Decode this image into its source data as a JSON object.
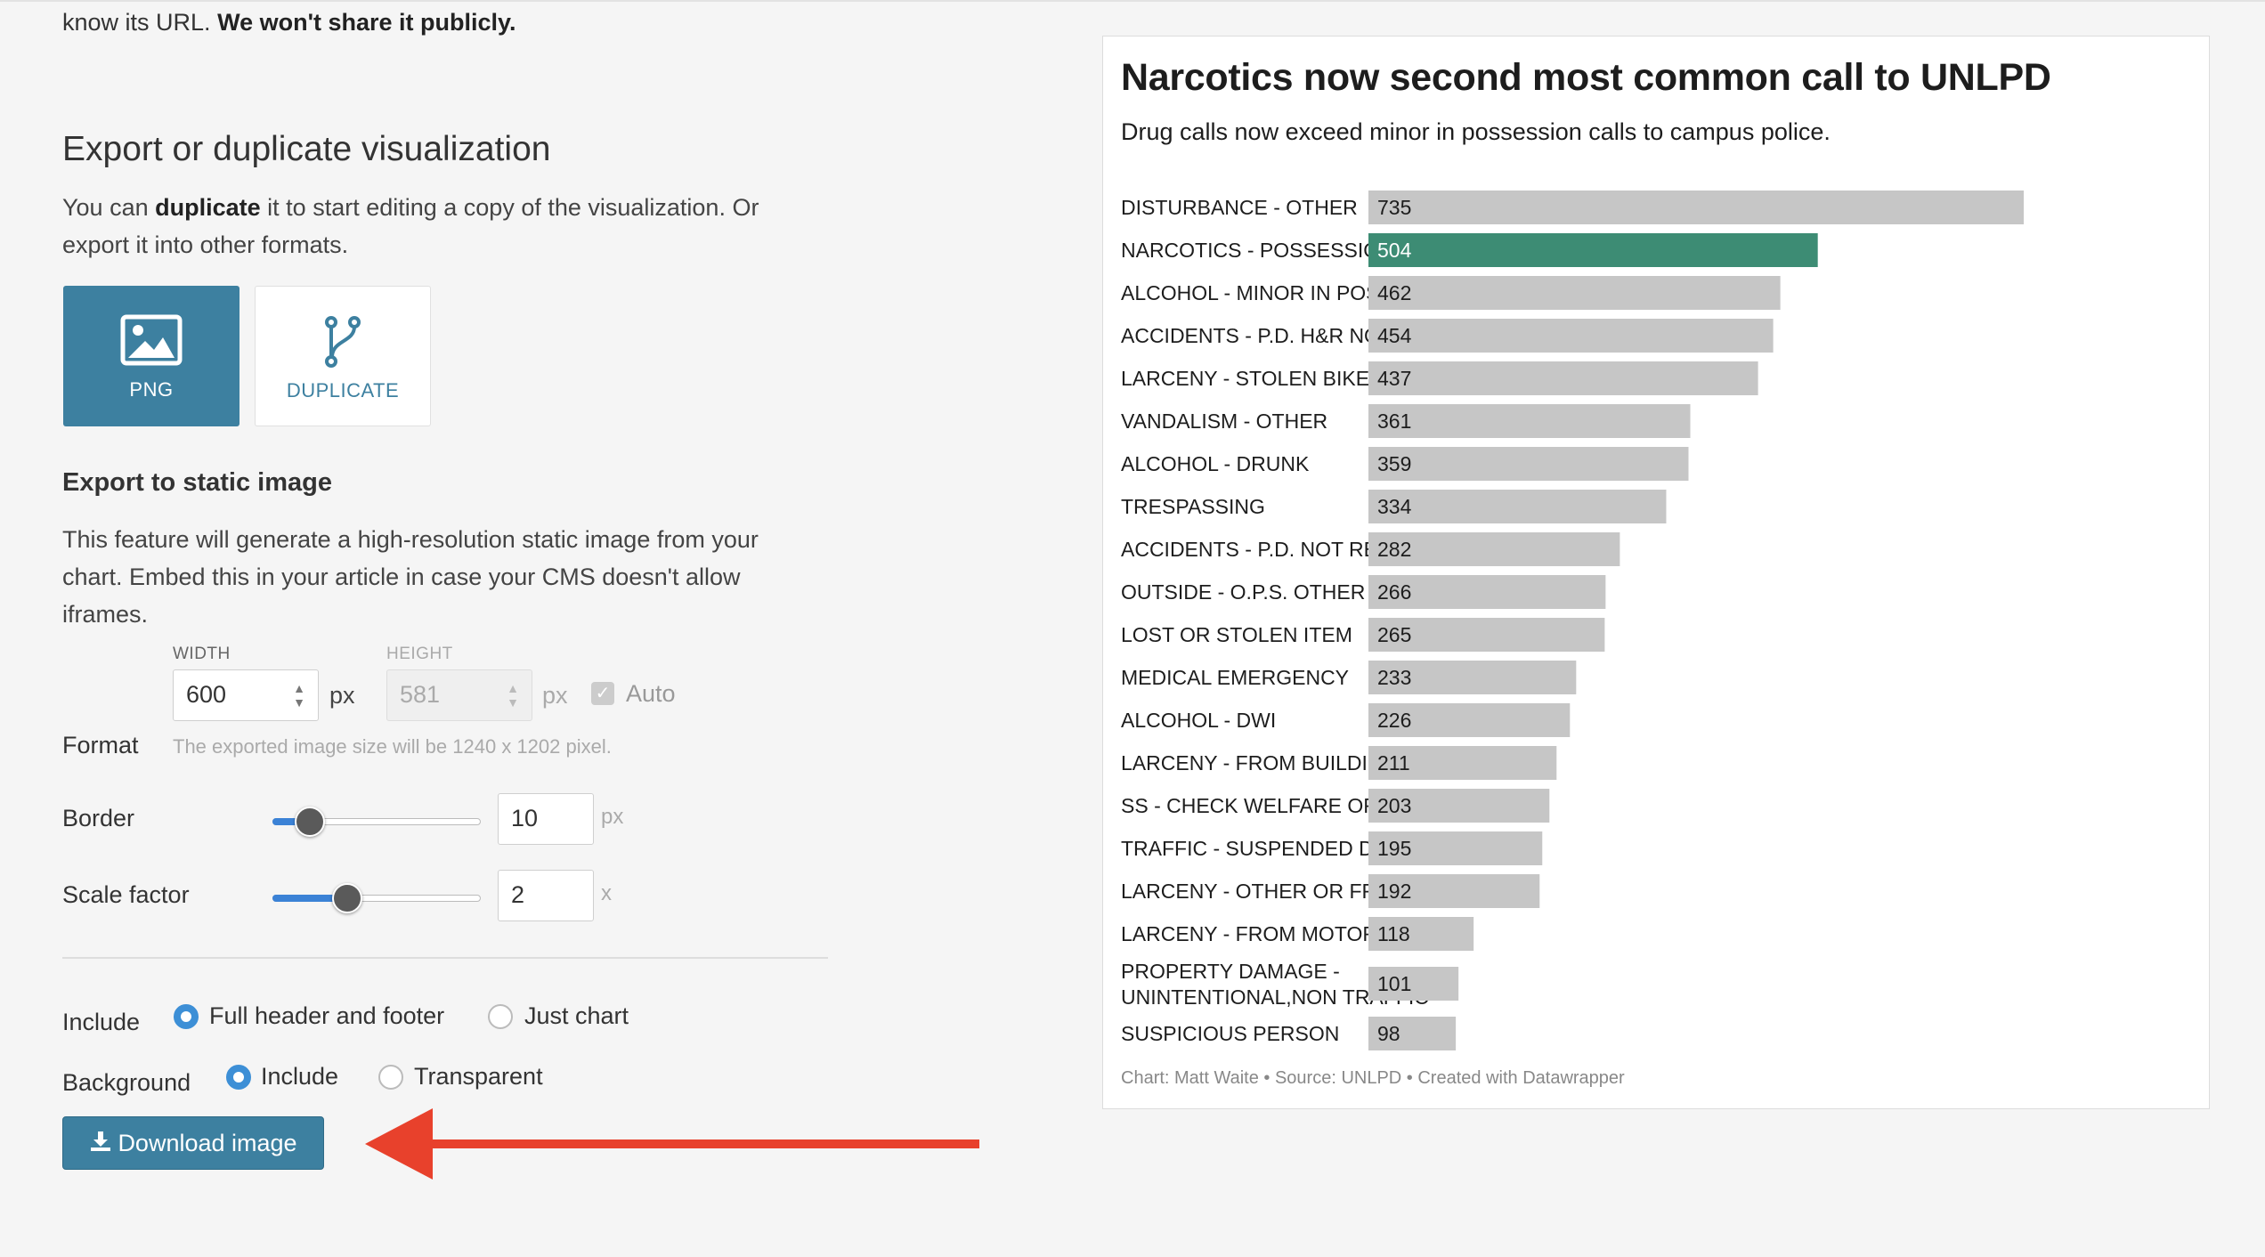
{
  "intro": {
    "text": "know its URL.",
    "bold": "We won't share it publicly."
  },
  "export": {
    "heading": "Export or duplicate visualization",
    "desc_pre": "You can",
    "desc_bold": "duplicate",
    "desc_post": "it to start editing a copy of the visualization. Or export it into other formats.",
    "png_label": "PNG",
    "duplicate_label": "DUPLICATE",
    "png_icon": "image-icon",
    "duplicate_icon": "fork-icon"
  },
  "static": {
    "heading": "Export to static image",
    "desc": "This feature will generate a high-resolution static image from your chart. Embed this in your article in case your CMS doesn't allow iframes.",
    "width_label": "WIDTH",
    "width_value": "600",
    "height_label": "HEIGHT",
    "height_value": "581",
    "unit_px": "px",
    "auto_label": "Auto",
    "auto_checked": true,
    "format_label": "Format",
    "format_hint": "The exported image size will be 1240 x 1202 pixel.",
    "border_label": "Border",
    "border_value": "10",
    "border_unit": "px",
    "border_level": 0.18,
    "scale_label": "Scale factor",
    "scale_value": "2",
    "scale_unit": "x",
    "scale_level": 0.36,
    "include_label": "Include",
    "include_options": [
      "Full header and footer",
      "Just chart"
    ],
    "include_selected": "Full header and footer",
    "background_label": "Background",
    "background_options": [
      "Include",
      "Transparent"
    ],
    "background_selected": "Include",
    "download_label": "Download image",
    "download_icon": "download-icon"
  },
  "annotation": {
    "arrow_color": "#e8412c"
  },
  "colors": {
    "accent": "#3d80a0",
    "bar_default": "#c6c6c6",
    "bar_highlight": "#3d8c74"
  },
  "chart": {
    "title": "Narcotics now second most common call to UNLPD",
    "subtitle": "Drug calls now exceed minor in possession calls to campus police.",
    "footer": "Chart: Matt Waite • Source: UNLPD • Created with Datawrapper"
  },
  "chart_data": {
    "type": "bar",
    "orientation": "horizontal",
    "categories": [
      "DISTURBANCE - OTHER",
      "NARCOTICS - POSSESSION",
      "ALCOHOL - MINOR IN POSSESSION",
      "ACCIDENTS - P.D. H&R NOT REPORTABLE",
      "LARCENY - STOLEN BIKE",
      "VANDALISM - OTHER",
      "ALCOHOL - DRUNK",
      "TRESPASSING",
      "ACCIDENTS - P.D. NOT REPORTABLE",
      "OUTSIDE - O.P.S. OTHER",
      "LOST OR STOLEN ITEM",
      "MEDICAL EMERGENCY",
      "ALCOHOL - DWI",
      "LARCENY - FROM BUILDING",
      "SS - CHECK WELFARE OF PERSON",
      "TRAFFIC - SUSPENDED DRIVER",
      "LARCENY - OTHER OR FROM OPEN AREA",
      "LARCENY - FROM MOTOR VEHICLE",
      "PROPERTY DAMAGE - UNINTENTIONAL,NON TRAFFIC",
      "SUSPICIOUS PERSON"
    ],
    "label_lines": [
      [
        "DISTURBANCE - OTHER"
      ],
      [
        "NARCOTICS - POSSESSION"
      ],
      [
        "ALCOHOL - MINOR IN POSSESSION"
      ],
      [
        "ACCIDENTS - P.D. H&R NOT REPORTABLE"
      ],
      [
        "LARCENY - STOLEN BIKE"
      ],
      [
        "VANDALISM - OTHER"
      ],
      [
        "ALCOHOL - DRUNK"
      ],
      [
        "TRESPASSING"
      ],
      [
        "ACCIDENTS - P.D. NOT REPORTABLE"
      ],
      [
        "OUTSIDE - O.P.S. OTHER"
      ],
      [
        "LOST OR STOLEN ITEM"
      ],
      [
        "MEDICAL EMERGENCY"
      ],
      [
        "ALCOHOL - DWI"
      ],
      [
        "LARCENY - FROM BUILDING"
      ],
      [
        "SS - CHECK WELFARE OF PERSON"
      ],
      [
        "TRAFFIC - SUSPENDED DRIVER"
      ],
      [
        "LARCENY - OTHER OR FROM OPEN AREA"
      ],
      [
        "LARCENY - FROM MOTOR VEHICLE"
      ],
      [
        "PROPERTY DAMAGE -",
        "UNINTENTIONAL,NON TRAFFIC"
      ],
      [
        "SUSPICIOUS PERSON"
      ]
    ],
    "values": [
      735,
      504,
      462,
      454,
      437,
      361,
      359,
      334,
      282,
      266,
      265,
      233,
      226,
      211,
      203,
      195,
      192,
      118,
      101,
      98
    ],
    "highlight_index": 1,
    "xlim": [
      0,
      735
    ],
    "title": "Narcotics now second most common call to UNLPD",
    "subtitle": "Drug calls now exceed minor in possession calls to campus police.",
    "xlabel": "",
    "ylabel": "",
    "grid": false,
    "legend": "none"
  }
}
